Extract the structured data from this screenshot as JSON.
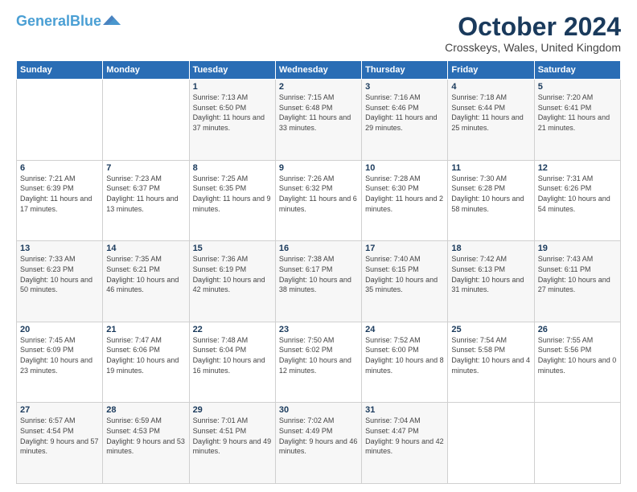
{
  "logo": {
    "line1": "General",
    "line2": "Blue"
  },
  "header": {
    "title": "October 2024",
    "subtitle": "Crosskeys, Wales, United Kingdom"
  },
  "weekdays": [
    "Sunday",
    "Monday",
    "Tuesday",
    "Wednesday",
    "Thursday",
    "Friday",
    "Saturday"
  ],
  "weeks": [
    [
      {
        "day": "",
        "info": ""
      },
      {
        "day": "",
        "info": ""
      },
      {
        "day": "1",
        "info": "Sunrise: 7:13 AM\nSunset: 6:50 PM\nDaylight: 11 hours and 37 minutes."
      },
      {
        "day": "2",
        "info": "Sunrise: 7:15 AM\nSunset: 6:48 PM\nDaylight: 11 hours and 33 minutes."
      },
      {
        "day": "3",
        "info": "Sunrise: 7:16 AM\nSunset: 6:46 PM\nDaylight: 11 hours and 29 minutes."
      },
      {
        "day": "4",
        "info": "Sunrise: 7:18 AM\nSunset: 6:44 PM\nDaylight: 11 hours and 25 minutes."
      },
      {
        "day": "5",
        "info": "Sunrise: 7:20 AM\nSunset: 6:41 PM\nDaylight: 11 hours and 21 minutes."
      }
    ],
    [
      {
        "day": "6",
        "info": "Sunrise: 7:21 AM\nSunset: 6:39 PM\nDaylight: 11 hours and 17 minutes."
      },
      {
        "day": "7",
        "info": "Sunrise: 7:23 AM\nSunset: 6:37 PM\nDaylight: 11 hours and 13 minutes."
      },
      {
        "day": "8",
        "info": "Sunrise: 7:25 AM\nSunset: 6:35 PM\nDaylight: 11 hours and 9 minutes."
      },
      {
        "day": "9",
        "info": "Sunrise: 7:26 AM\nSunset: 6:32 PM\nDaylight: 11 hours and 6 minutes."
      },
      {
        "day": "10",
        "info": "Sunrise: 7:28 AM\nSunset: 6:30 PM\nDaylight: 11 hours and 2 minutes."
      },
      {
        "day": "11",
        "info": "Sunrise: 7:30 AM\nSunset: 6:28 PM\nDaylight: 10 hours and 58 minutes."
      },
      {
        "day": "12",
        "info": "Sunrise: 7:31 AM\nSunset: 6:26 PM\nDaylight: 10 hours and 54 minutes."
      }
    ],
    [
      {
        "day": "13",
        "info": "Sunrise: 7:33 AM\nSunset: 6:23 PM\nDaylight: 10 hours and 50 minutes."
      },
      {
        "day": "14",
        "info": "Sunrise: 7:35 AM\nSunset: 6:21 PM\nDaylight: 10 hours and 46 minutes."
      },
      {
        "day": "15",
        "info": "Sunrise: 7:36 AM\nSunset: 6:19 PM\nDaylight: 10 hours and 42 minutes."
      },
      {
        "day": "16",
        "info": "Sunrise: 7:38 AM\nSunset: 6:17 PM\nDaylight: 10 hours and 38 minutes."
      },
      {
        "day": "17",
        "info": "Sunrise: 7:40 AM\nSunset: 6:15 PM\nDaylight: 10 hours and 35 minutes."
      },
      {
        "day": "18",
        "info": "Sunrise: 7:42 AM\nSunset: 6:13 PM\nDaylight: 10 hours and 31 minutes."
      },
      {
        "day": "19",
        "info": "Sunrise: 7:43 AM\nSunset: 6:11 PM\nDaylight: 10 hours and 27 minutes."
      }
    ],
    [
      {
        "day": "20",
        "info": "Sunrise: 7:45 AM\nSunset: 6:09 PM\nDaylight: 10 hours and 23 minutes."
      },
      {
        "day": "21",
        "info": "Sunrise: 7:47 AM\nSunset: 6:06 PM\nDaylight: 10 hours and 19 minutes."
      },
      {
        "day": "22",
        "info": "Sunrise: 7:48 AM\nSunset: 6:04 PM\nDaylight: 10 hours and 16 minutes."
      },
      {
        "day": "23",
        "info": "Sunrise: 7:50 AM\nSunset: 6:02 PM\nDaylight: 10 hours and 12 minutes."
      },
      {
        "day": "24",
        "info": "Sunrise: 7:52 AM\nSunset: 6:00 PM\nDaylight: 10 hours and 8 minutes."
      },
      {
        "day": "25",
        "info": "Sunrise: 7:54 AM\nSunset: 5:58 PM\nDaylight: 10 hours and 4 minutes."
      },
      {
        "day": "26",
        "info": "Sunrise: 7:55 AM\nSunset: 5:56 PM\nDaylight: 10 hours and 0 minutes."
      }
    ],
    [
      {
        "day": "27",
        "info": "Sunrise: 6:57 AM\nSunset: 4:54 PM\nDaylight: 9 hours and 57 minutes."
      },
      {
        "day": "28",
        "info": "Sunrise: 6:59 AM\nSunset: 4:53 PM\nDaylight: 9 hours and 53 minutes."
      },
      {
        "day": "29",
        "info": "Sunrise: 7:01 AM\nSunset: 4:51 PM\nDaylight: 9 hours and 49 minutes."
      },
      {
        "day": "30",
        "info": "Sunrise: 7:02 AM\nSunset: 4:49 PM\nDaylight: 9 hours and 46 minutes."
      },
      {
        "day": "31",
        "info": "Sunrise: 7:04 AM\nSunset: 4:47 PM\nDaylight: 9 hours and 42 minutes."
      },
      {
        "day": "",
        "info": ""
      },
      {
        "day": "",
        "info": ""
      }
    ]
  ]
}
